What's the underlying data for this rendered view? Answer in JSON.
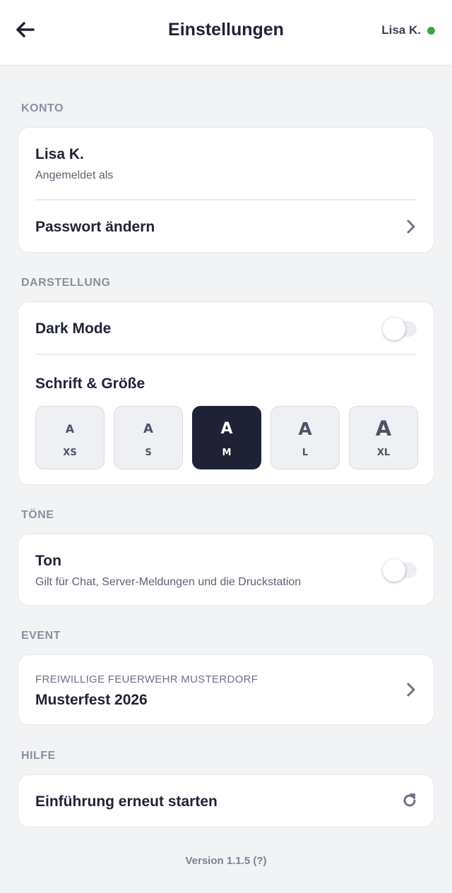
{
  "header": {
    "title": "Einstellungen",
    "user_name": "Lisa K.",
    "status_color": "#3ca24a"
  },
  "sections": {
    "konto": {
      "label": "KONTO",
      "name": "Lisa K.",
      "signed_in_as": "Angemeldet als",
      "change_password": "Passwort ändern"
    },
    "darstellung": {
      "label": "DARSTELLUNG",
      "dark_mode": "Dark Mode",
      "dark_mode_on": false,
      "font_size_title": "Schrift & Größe",
      "size_glyph": "A",
      "sizes": [
        "XS",
        "S",
        "M",
        "L",
        "XL"
      ],
      "selected_size": "M"
    },
    "toene": {
      "label": "TÖNE",
      "title": "Ton",
      "description": "Gilt für Chat, Server-Meldungen und die Druckstation",
      "sound_on": false
    },
    "event": {
      "label": "EVENT",
      "organization": "FREIWILLIGE FEUERWEHR MUSTERDORF",
      "name": "Musterfest 2026"
    },
    "hilfe": {
      "label": "HILFE",
      "restart_intro": "Einführung erneut starten"
    }
  },
  "footer": {
    "version": "Version 1.1.5 (?)"
  },
  "colors": {
    "accent_dark": "#1f2235",
    "background": "#f2f3f5",
    "muted": "#8a8fa0"
  }
}
